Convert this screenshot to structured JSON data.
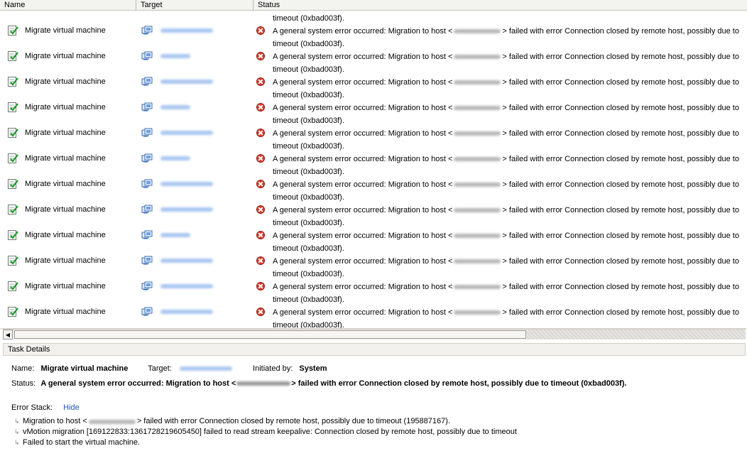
{
  "columns": {
    "name": "Name",
    "target": "Target",
    "status": "Status"
  },
  "first_row_tail": "timeout (0xbad003f).",
  "rows": [
    {
      "name": "Migrate virtual machine",
      "target_w": 74,
      "status_a": "A general system error occurred: Migration to host <",
      "status_b": "> failed with error Connection closed by remote host, possibly due to",
      "status_c": "timeout (0xbad003f)."
    },
    {
      "name": "Migrate virtual machine",
      "target_w": 42,
      "status_a": "A general system error occurred: Migration to host <",
      "status_b": "> failed with error Connection closed by remote host, possibly due to",
      "status_c": "timeout (0xbad003f)."
    },
    {
      "name": "Migrate virtual machine",
      "target_w": 74,
      "status_a": "A general system error occurred: Migration to host <",
      "status_b": "> failed with error Connection closed by remote host, possibly due to",
      "status_c": "timeout (0xbad003f)."
    },
    {
      "name": "Migrate virtual machine",
      "target_w": 42,
      "status_a": "A general system error occurred: Migration to host <",
      "status_b": "> failed with error Connection closed by remote host, possibly due to",
      "status_c": "timeout (0xbad003f)."
    },
    {
      "name": "Migrate virtual machine",
      "target_w": 74,
      "status_a": "A general system error occurred: Migration to host <",
      "status_b": "> failed with error Connection closed by remote host, possibly due to",
      "status_c": "timeout (0xbad003f)."
    },
    {
      "name": "Migrate virtual machine",
      "target_w": 42,
      "status_a": "A general system error occurred: Migration to host <",
      "status_b": "> failed with error Connection closed by remote host, possibly due to",
      "status_c": "timeout (0xbad003f)."
    },
    {
      "name": "Migrate virtual machine",
      "target_w": 74,
      "status_a": "A general system error occurred: Migration to host <",
      "status_b": "> failed with error Connection closed by remote host, possibly due to",
      "status_c": "timeout (0xbad003f)."
    },
    {
      "name": "Migrate virtual machine",
      "target_w": 74,
      "status_a": "A general system error occurred: Migration to host <",
      "status_b": "> failed with error Connection closed by remote host, possibly due to",
      "status_c": "timeout (0xbad003f)."
    },
    {
      "name": "Migrate virtual machine",
      "target_w": 42,
      "status_a": "A general system error occurred: Migration to host <",
      "status_b": "> failed with error Connection closed by remote host, possibly due to",
      "status_c": "timeout (0xbad003f)."
    },
    {
      "name": "Migrate virtual machine",
      "target_w": 74,
      "status_a": "A general system error occurred: Migration to host <",
      "status_b": "> failed with error Connection closed by remote host, possibly due to",
      "status_c": "timeout (0xbad003f)."
    },
    {
      "name": "Migrate virtual machine",
      "target_w": 74,
      "status_a": "A general system error occurred: Migration to host <",
      "status_b": "> failed with error Connection closed by remote host, possibly due to",
      "status_c": "timeout (0xbad003f)."
    },
    {
      "name": "Migrate virtual machine",
      "target_w": 74,
      "status_a": "A general system error occurred: Migration to host <",
      "status_b": "> failed with error Connection closed by remote host, possibly due to",
      "status_c": "timeout (0xbad003f)."
    }
  ],
  "task_details": {
    "title": "Task Details",
    "name_label": "Name:",
    "name_value": "Migrate virtual machine",
    "target_label": "Target:",
    "initiated_label": "Initiated by:",
    "initiated_value": "System",
    "status_label": "Status:",
    "status_a": "A general system error occurred: Migration to host <",
    "status_b": "> failed with error Connection closed by remote host, possibly due to timeout (0xbad003f).",
    "error_stack_label": "Error Stack:",
    "hide_label": "Hide",
    "stack": [
      {
        "a": "Migration to host <",
        "b": "> failed with error Connection closed by remote host, possibly due to timeout (195887167).",
        "has_host": true
      },
      {
        "a": "vMotion migration [169122833:1361728219605450] failed to read stream keepalive: Connection closed by remote host, possibly due to timeout",
        "b": "",
        "has_host": false
      },
      {
        "a": "Failed to start the virtual machine.",
        "b": "",
        "has_host": false
      }
    ]
  },
  "icons": {
    "task": "task-check-icon",
    "vm": "virtual-machine-icon",
    "error": "error-icon",
    "scroll_left": "scroll-left-arrow-icon",
    "stack_arrow": "stack-arrow-icon"
  }
}
